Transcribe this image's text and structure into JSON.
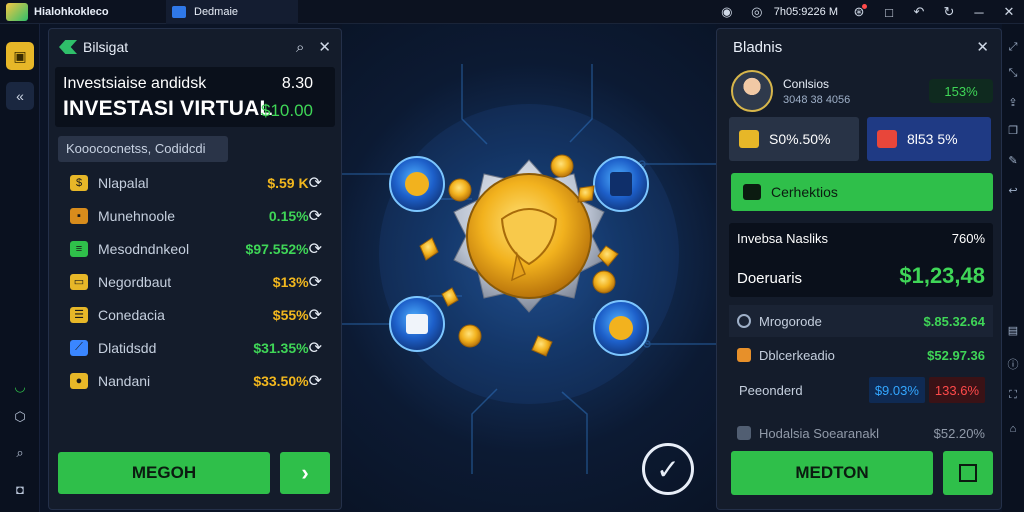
{
  "app": {
    "title": "Hialohkokleco",
    "tab_label": "Dedmaie",
    "clock": "7h05:9226 M"
  },
  "icons": {
    "topbar": [
      "history-icon",
      "clock-icon",
      "notification-icon",
      "window-icon",
      "undo-icon",
      "refresh-icon",
      "minimize-icon",
      "close-icon"
    ],
    "left_rail": [
      "wallet-icon",
      "back-icon",
      "status-icon",
      "settings-icon",
      "search-icon",
      "stop-icon"
    ],
    "right_rail": [
      "expand-icon",
      "collapse-icon",
      "share-icon",
      "copy-icon",
      "pen-icon",
      "back-arrow-icon",
      "image-icon",
      "info-icon",
      "fullscreen-icon",
      "home-icon"
    ]
  },
  "left_panel": {
    "title": "Bilsigat",
    "invest_subtitle": "Investsiaise andidsk",
    "invest_subtitle_value": "8.30",
    "invest_title": "INVESTASI VIRTUAL",
    "invest_value": "$10.00",
    "chip_text": "Kooococnetss, Codidcdi",
    "rows": [
      {
        "label": "Nlapalal",
        "value": "$.59 K",
        "value_color": "#f2b71e",
        "icon_color": "#e7b728",
        "icon": "coin-icon"
      },
      {
        "label": "Munehnoole",
        "value": "0.15%",
        "value_color": "#3fd657",
        "icon_color": "#d88c1c",
        "icon": "box-icon"
      },
      {
        "label": "Mesodndnkeol",
        "value": "$97.552%",
        "value_color": "#3fd657",
        "icon_color": "#2fbf4a",
        "icon": "stack-icon"
      },
      {
        "label": "Negordbaut",
        "value": "$13%",
        "value_color": "#f2b71e",
        "icon_color": "#e7b728",
        "icon": "card-icon"
      },
      {
        "label": "Conedacia",
        "value": "$55%",
        "value_color": "#f2b71e",
        "icon_color": "#e7b728",
        "icon": "list-icon"
      },
      {
        "label": "Dlatidsdd",
        "value": "$31.35%",
        "value_color": "#3fd657",
        "icon_color": "#3a86ff",
        "icon": "chart-icon"
      },
      {
        "label": "Nandani",
        "value": "$33.50%",
        "value_color": "#f2b71e",
        "icon_color": "#e7b728",
        "icon": "bag-icon"
      }
    ],
    "button_label": "MEGOH"
  },
  "right_panel": {
    "title": "Bladnis",
    "profile_name": "Conlsios",
    "profile_id": "3048 38 4056",
    "profile_badge": "153%",
    "tile1_label": "S0%.50%",
    "tile2_label": "8l53 5%",
    "green_label": "Cerhektios",
    "summary_title": "Invebsa Nasliks",
    "summary_title_value": "760%",
    "summary_label": "Doeruaris",
    "summary_value": "$1,23,48",
    "rows": [
      {
        "label": "Mrogorode",
        "value": "$.85.32.64",
        "icon": "target-icon",
        "icon_color": "#9fb0c8"
      },
      {
        "label": "Dblcerkeadio",
        "value": "$52.97.36",
        "icon": "box-icon",
        "icon_color": "#e7902a"
      }
    ],
    "pill_row_label": "Peeonderd",
    "pill_blue": "$9.03%",
    "pill_red": "133.6%",
    "last_row_label": "Hodalsia Soearanakl",
    "last_row_value": "$52.20%",
    "button_label": "MEDTON"
  },
  "accent_colors": {
    "green": "#2fbf4a",
    "gold": "#f2b71e",
    "blue": "#33a6ff",
    "red": "#ff4a4a"
  }
}
